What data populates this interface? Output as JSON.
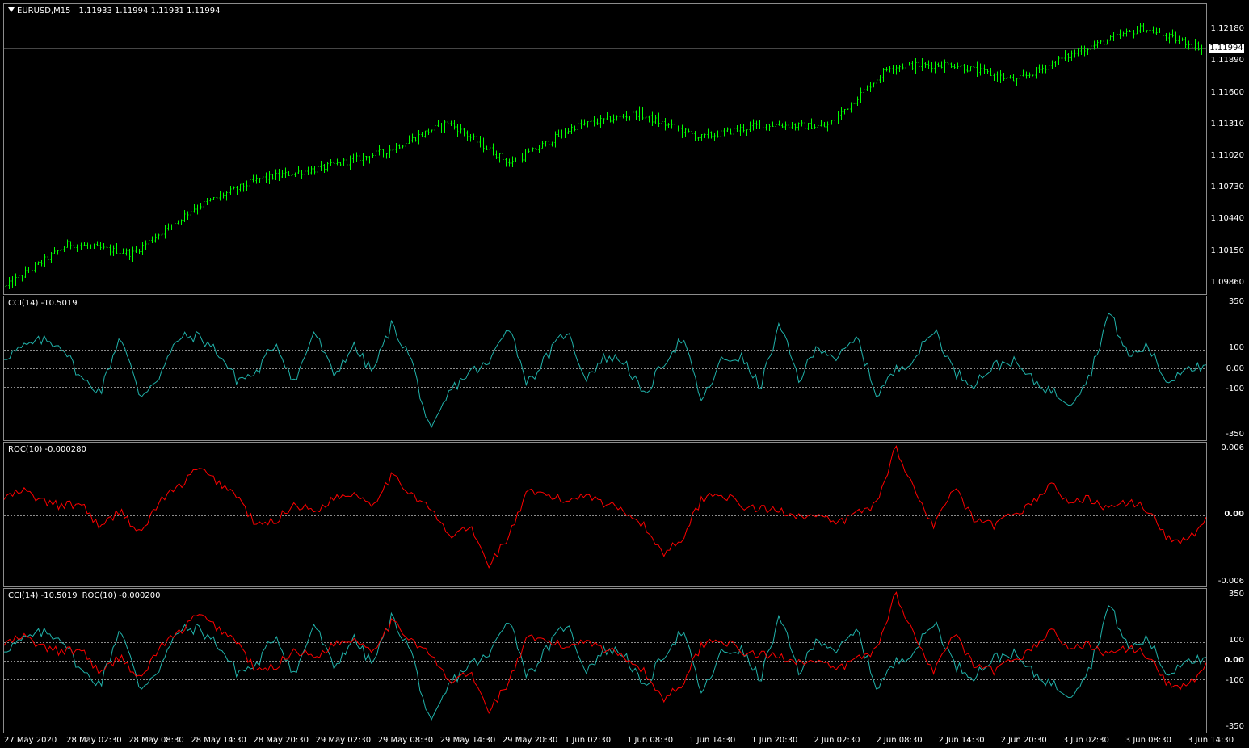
{
  "chart_window": {
    "symbol": "EURUSD",
    "timeframe": "M15",
    "ohlc": "1.11933 1.11994 1.11931 1.11994",
    "bid_price": "1.11994"
  },
  "colors": {
    "background": "#000000",
    "candles": "#00ff00",
    "cci": "#20b2aa",
    "roc": "#ff0000",
    "grid": "#8c8c8c",
    "text": "#ffffff"
  },
  "panes": {
    "main": {
      "price_labels": [
        "1.12180",
        "1.11890",
        "1.11600",
        "1.11310",
        "1.11020",
        "1.10730",
        "1.10440",
        "1.10150",
        "1.09860"
      ]
    },
    "cci": {
      "label": "CCI(14) -10.5019",
      "scale_labels": [
        "350",
        "100",
        "0.00",
        "-100",
        "-350"
      ]
    },
    "roc": {
      "label": "ROC(10) -0.000280",
      "scale_labels": [
        "0.006",
        "0.00",
        "-0.006"
      ]
    },
    "combo": {
      "label_cci": "CCI(14) -10.5019",
      "label_roc": "ROC(10) -0.000200",
      "scale_labels": [
        "350",
        "100",
        "0.00",
        "-100",
        "-350"
      ]
    }
  },
  "time_axis": [
    "27 May 2020",
    "28 May 02:30",
    "28 May 08:30",
    "28 May 14:30",
    "28 May 20:30",
    "29 May 02:30",
    "29 May 08:30",
    "29 May 14:30",
    "29 May 20:30",
    "1 Jun 02:30",
    "1 Jun 08:30",
    "1 Jun 14:30",
    "1 Jun 20:30",
    "2 Jun 02:30",
    "2 Jun 08:30",
    "2 Jun 14:30",
    "2 Jun 20:30",
    "3 Jun 02:30",
    "3 Jun 08:30",
    "3 Jun 14:30"
  ],
  "chart_data": [
    {
      "type": "candlestick",
      "title": "EURUSD,M15",
      "ylim": [
        1.0975,
        1.124
      ],
      "close_path": [
        {
          "x": "27 May 2020",
          "y": 1.0982
        },
        {
          "x": "28 May 02:30",
          "y": 1.1021
        },
        {
          "x": "28 May 08:30",
          "y": 1.1012
        },
        {
          "x": "28 May 14:30",
          "y": 1.1054
        },
        {
          "x": "28 May 20:30",
          "y": 1.108
        },
        {
          "x": "29 May 02:30",
          "y": 1.109
        },
        {
          "x": "29 May 08:30",
          "y": 1.1105
        },
        {
          "x": "29 May 14:30",
          "y": 1.1132
        },
        {
          "x": "29 May 20:30",
          "y": 1.1094
        },
        {
          "x": "1 Jun 02:30",
          "y": 1.1128
        },
        {
          "x": "1 Jun 08:30",
          "y": 1.114
        },
        {
          "x": "1 Jun 14:30",
          "y": 1.1118
        },
        {
          "x": "1 Jun 20:30",
          "y": 1.113
        },
        {
          "x": "2 Jun 02:30",
          "y": 1.1128
        },
        {
          "x": "2 Jun 08:30",
          "y": 1.1183
        },
        {
          "x": "2 Jun 14:30",
          "y": 1.1185
        },
        {
          "x": "2 Jun 20:30",
          "y": 1.117
        },
        {
          "x": "3 Jun 02:30",
          "y": 1.1197
        },
        {
          "x": "3 Jun 08:30",
          "y": 1.1218
        },
        {
          "x": "3 Jun 14:30",
          "y": 1.1199
        }
      ]
    },
    {
      "type": "line",
      "title": "CCI(14)",
      "ylim": [
        -350,
        350
      ],
      "reference_levels": [
        100,
        0,
        -100
      ],
      "series": [
        {
          "name": "CCI(14)",
          "values": [
            60,
            110,
            150,
            120,
            -60,
            -120,
            180,
            -150,
            -40,
            160,
            170,
            90,
            -60,
            -30,
            140,
            -80,
            200,
            -40,
            120,
            -20,
            230,
            50,
            -350,
            -120,
            -20,
            20,
            240,
            -80,
            60,
            200,
            -50,
            60,
            40,
            -150,
            30,
            160,
            -180,
            40,
            60,
            -100,
            230,
            -60,
            120,
            50,
            160,
            -140,
            -10,
            60,
            210,
            -20,
            -80,
            10,
            40,
            -60,
            -120,
            -180,
            -40,
            300,
            60,
            120,
            -80,
            20,
            -10
          ]
        }
      ],
      "current_value": -10.5019
    },
    {
      "type": "line",
      "title": "ROC(10)",
      "ylim": [
        -0.006,
        0.006
      ],
      "reference_levels": [
        0
      ],
      "series": [
        {
          "name": "ROC(10)",
          "values": [
            0.0015,
            0.0022,
            0.0012,
            0.0008,
            0.001,
            -0.0012,
            0.0005,
            -0.0018,
            0.0012,
            0.0025,
            0.0042,
            0.003,
            0.0018,
            -0.001,
            -0.0005,
            0.001,
            0.0003,
            0.0015,
            0.002,
            0.001,
            0.0035,
            0.002,
            0.0005,
            -0.002,
            -0.001,
            -0.0045,
            -0.002,
            0.002,
            0.0018,
            0.0012,
            0.002,
            0.001,
            0.0005,
            -0.001,
            -0.0035,
            -0.002,
            0.0015,
            0.002,
            0.0008,
            0.0005,
            0.0004,
            0.0,
            -0.0002,
            -0.0008,
            0.0002,
            0.001,
            0.0062,
            0.002,
            -0.001,
            0.0025,
            -0.0005,
            -0.001,
            0.0,
            0.001,
            0.0028,
            0.001,
            0.0015,
            0.0005,
            0.0012,
            0.0005,
            -0.002,
            -0.0025,
            -0.0003
          ]
        }
      ],
      "current_value": -0.00028
    },
    {
      "type": "line",
      "title": "CCI(14) / ROC(10)",
      "ylim": [
        -350,
        350
      ],
      "reference_levels": [
        100,
        0,
        -100
      ],
      "series": [
        {
          "name": "CCI(14)",
          "values": "same as CCI(14) pane"
        },
        {
          "name": "ROC(10)",
          "values": "same as ROC(10) pane, scaled to CCI range"
        }
      ]
    }
  ]
}
